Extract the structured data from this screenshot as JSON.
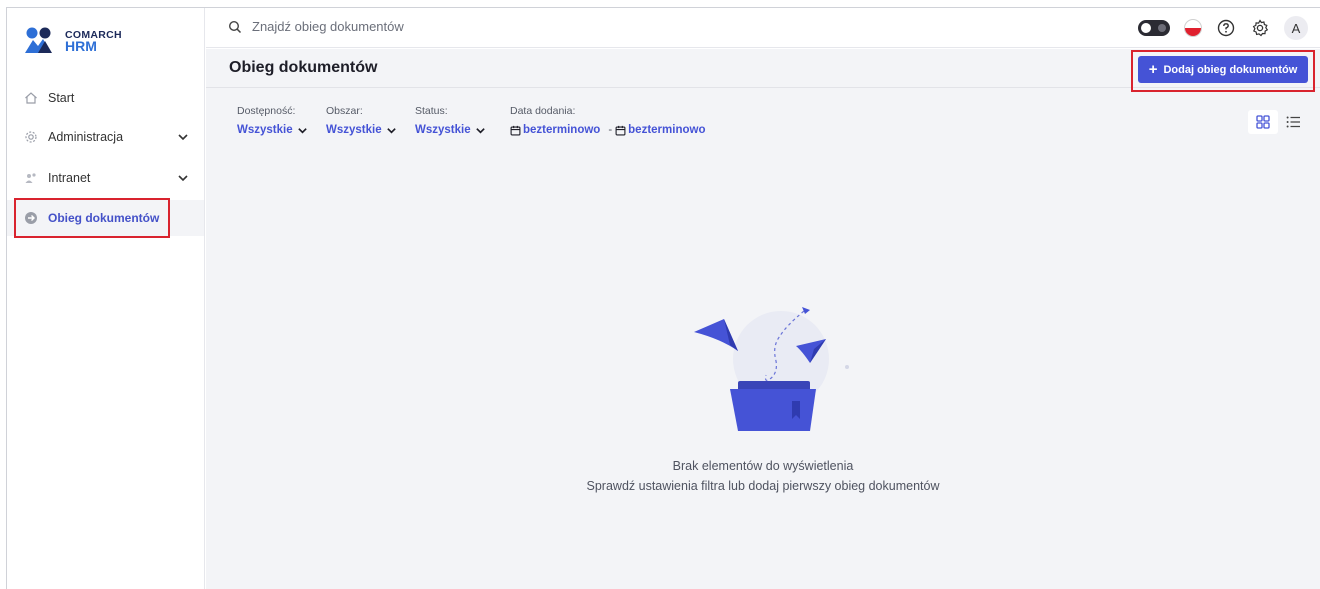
{
  "app": {
    "brand": "COMARCH",
    "product": "HRM"
  },
  "sidebar": {
    "items": [
      {
        "label": "Start",
        "icon": "home-icon"
      },
      {
        "label": "Administracja",
        "icon": "gear-icon",
        "expandable": true
      },
      {
        "label": "Intranet",
        "icon": "people-icon",
        "expandable": true
      },
      {
        "label": "Obieg dokumentów",
        "icon": "document-flow-icon",
        "active": true
      }
    ]
  },
  "topbar": {
    "search_placeholder": "Znajdź obieg dokumentów",
    "avatar_initial": "A"
  },
  "main": {
    "page_title": "Obieg dokumentów",
    "add_button_label": "Dodaj obieg dokumentów",
    "filters": {
      "availability": {
        "label": "Dostępność:",
        "value": "Wszystkie"
      },
      "area": {
        "label": "Obszar:",
        "value": "Wszystkie"
      },
      "status": {
        "label": "Status:",
        "value": "Wszystkie"
      },
      "date_added": {
        "label": "Data dodania:",
        "from": "bezterminowo",
        "separator": "-",
        "to": "bezterminowo"
      }
    },
    "empty_state": {
      "title": "Brak elementów do wyświetlenia",
      "subtitle": "Sprawdź ustawienia filtra lub dodaj pierwszy obieg dokumentów"
    }
  },
  "colors": {
    "accent": "#4553d6",
    "highlight": "#d9232e",
    "background": "#f3f4f7"
  }
}
